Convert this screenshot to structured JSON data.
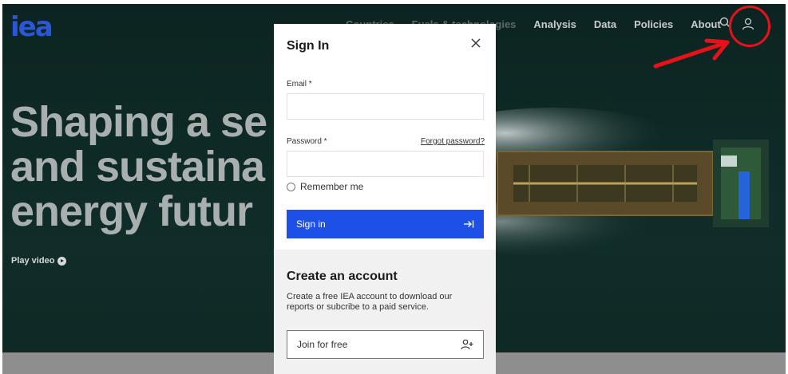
{
  "header": {
    "logo": "iea",
    "nav": [
      {
        "label": "Countries",
        "dim": true
      },
      {
        "label": "Fuels & technologies",
        "dim": true
      },
      {
        "label": "Analysis",
        "dim": false
      },
      {
        "label": "Data",
        "dim": false
      },
      {
        "label": "Policies",
        "dim": false
      },
      {
        "label": "About",
        "dim": false
      }
    ],
    "search_icon": "search-icon",
    "user_icon": "user-icon"
  },
  "hero": {
    "headline_lines": [
      "Shaping a se",
      "and sustaina",
      "energy futur"
    ],
    "play_label": "Play video"
  },
  "modal": {
    "title": "Sign In",
    "email_label": "Email *",
    "email_value": "",
    "password_label": "Password *",
    "password_value": "",
    "forgot_label": "Forgot password?",
    "remember_label": "Remember me",
    "signin_label": "Sign in",
    "create_title": "Create an account",
    "create_desc": "Create a free IEA account to download our reports or subcribe to a paid service.",
    "join_label": "Join for free"
  },
  "colors": {
    "brand_blue": "#1d50e6",
    "annotation_red": "#e8111a",
    "hero_bg": "#0e2a26"
  }
}
